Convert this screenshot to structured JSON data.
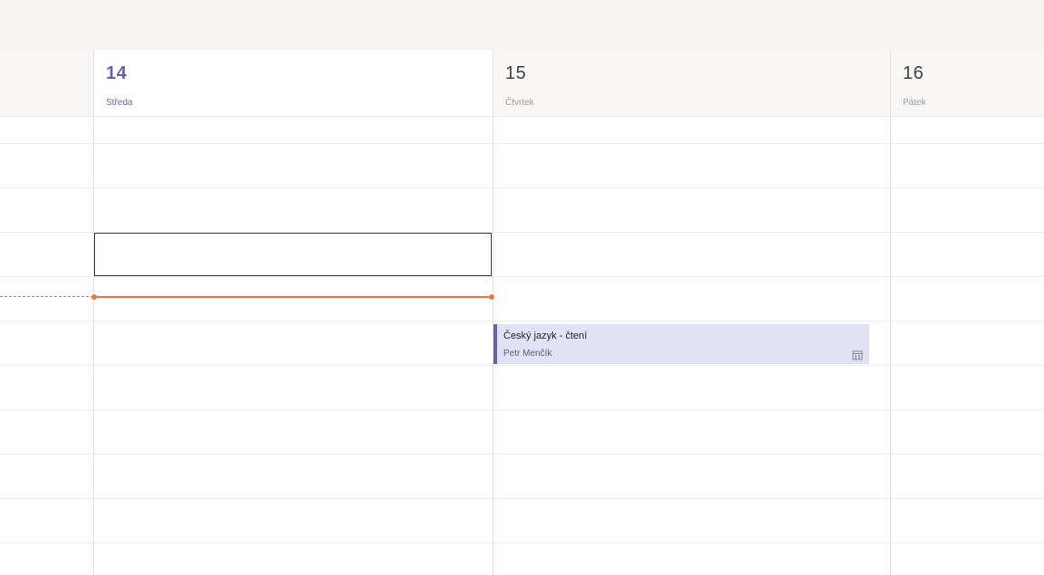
{
  "calendar": {
    "days": [
      {
        "number": "14",
        "name": "Středa",
        "today": true
      },
      {
        "number": "15",
        "name": "Čtvrtek",
        "today": false
      },
      {
        "number": "16",
        "name": "Pátek",
        "today": false
      }
    ],
    "events": [
      {
        "title": "Český jazyk - čtení",
        "organizer": "Petr Menčík",
        "icon": "calendar-icon"
      }
    ]
  },
  "colors": {
    "accent": "#6264a7",
    "now_indicator": "#e97548",
    "event_bg": "#e2e2f6"
  }
}
